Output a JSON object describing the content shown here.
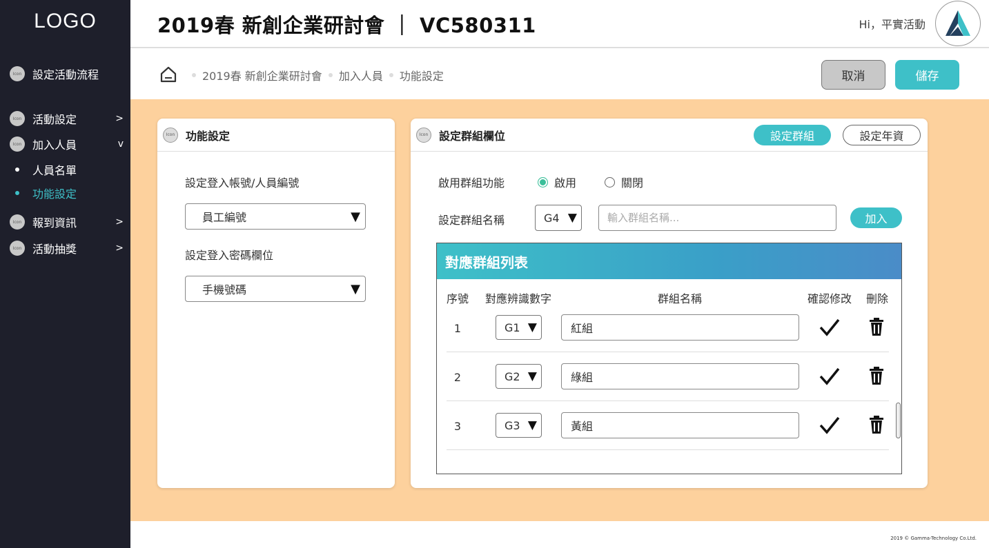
{
  "sidebar": {
    "logo": "LOGO",
    "icon_text": "Icon",
    "items": [
      {
        "label": "設定活動流程",
        "arrow": ""
      },
      {
        "label": "活動設定",
        "arrow": ">"
      },
      {
        "label": "加入人員",
        "arrow": "v"
      },
      {
        "label": "報到資訊",
        "arrow": ">"
      },
      {
        "label": "活動抽獎",
        "arrow": ">"
      }
    ],
    "sub_items": [
      {
        "label": "人員名單"
      },
      {
        "label": "功能設定"
      }
    ]
  },
  "header": {
    "title": "2019春 新創企業研討會 ｜ VC580311",
    "greeting": "Hi，平實活動"
  },
  "breadcrumb": {
    "items": [
      "2019春 新創企業研討會",
      "加入人員",
      "功能設定"
    ],
    "cancel_label": "取消",
    "save_label": "儲存"
  },
  "left_card": {
    "icon_text": "Icon",
    "title": "功能設定",
    "account_label": "設定登入帳號/人員編號",
    "account_value": "員工編號",
    "password_label": "設定登入密碼欄位",
    "password_value": "手機號碼"
  },
  "right_card": {
    "icon_text": "Icon",
    "title": "設定群組欄位",
    "tab_group": "設定群組",
    "tab_seniority": "設定年資",
    "enable_label": "啟用群組功能",
    "radio_on": "啟用",
    "radio_off": "關閉",
    "name_label": "設定群組名稱",
    "code_value": "G4",
    "name_placeholder": "輸入群組名稱...",
    "add_label": "加入",
    "table": {
      "title": "對應群組列表",
      "columns": [
        "序號",
        "對應辨識數字",
        "群組名稱",
        "確認修改",
        "刪除"
      ],
      "rows": [
        {
          "num": "1",
          "code": "G1",
          "name": "紅組"
        },
        {
          "num": "2",
          "code": "G2",
          "name": "綠組"
        },
        {
          "num": "3",
          "code": "G3",
          "name": "黃組"
        }
      ]
    }
  },
  "footer": "2019 ©  Gamma-Technology Co.Ltd.",
  "colors": {
    "sidebar_bg": "#1e1f2b",
    "accent": "#3ec0c8",
    "content_bg": "#fdd19d",
    "radio_on": "#3bbf9a"
  }
}
